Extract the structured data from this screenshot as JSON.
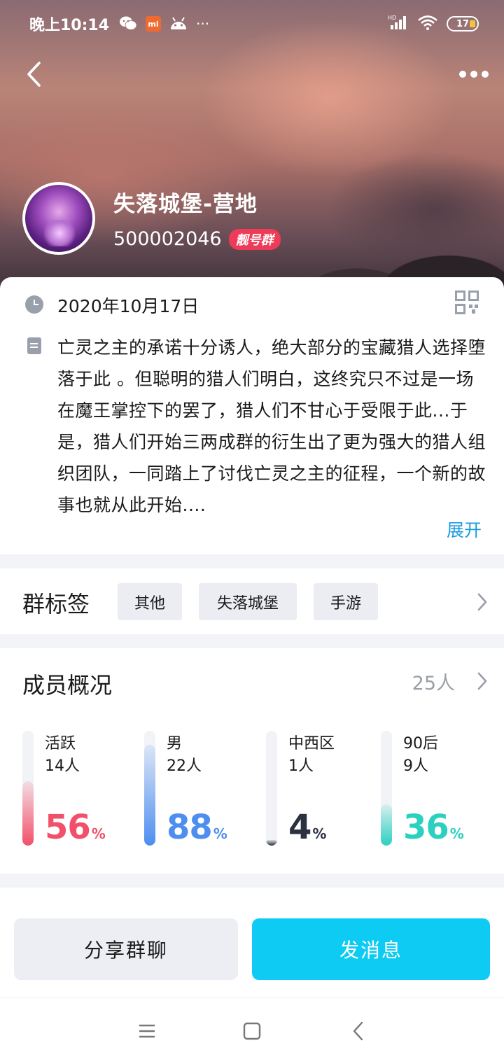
{
  "status_bar": {
    "time": "晚上10:14",
    "icons": [
      "wechat-icon",
      "mi-icon",
      "android-icon",
      "more-dots-icon"
    ],
    "mi_label": "mi",
    "dots": "···",
    "network_label": "HD",
    "battery_level": "17"
  },
  "header": {
    "back_icon": "back-arrow-icon",
    "more_icon": "more-icon",
    "group_name": "失落城堡-营地",
    "group_id": "500002046",
    "badge": "靓号群"
  },
  "info": {
    "date": "2020年10月17日",
    "description": "亡灵之主的承诺十分诱人，绝大部分的宝藏猎人选择堕落于此 。但聪明的猎人们明白，这终究只不过是一场在魔王掌控下的罢了，猎人们不甘心于受限于此...于是，猎人们开始三两成群的衍生出了更为强大的猎人组织团队，一同踏上了讨伐亡灵之主的征程，一个新的故事也就从此开始....",
    "expand_label": "展开"
  },
  "tags": {
    "title": "群标签",
    "items": [
      "其他",
      "失落城堡",
      "手游"
    ]
  },
  "members": {
    "title": "成员概况",
    "count": "25人",
    "stats": [
      {
        "label": "活跃",
        "count": "14人",
        "percent": "56",
        "value": 56,
        "color": "#f2506a"
      },
      {
        "label": "男",
        "count": "22人",
        "percent": "88",
        "value": 88,
        "color": "#4d8ef0"
      },
      {
        "label": "中西区",
        "count": "1人",
        "percent": "4",
        "value": 4,
        "color": "#2b3140"
      },
      {
        "label": "90后",
        "count": "9人",
        "percent": "36",
        "value": 36,
        "color": "#2bd0c0"
      }
    ],
    "percent_sign": "%"
  },
  "actions": {
    "share_label": "分享群聊",
    "send_label": "发消息"
  },
  "nav": {
    "icons": [
      "menu-icon",
      "home-square-icon",
      "back-triangle-icon"
    ]
  }
}
